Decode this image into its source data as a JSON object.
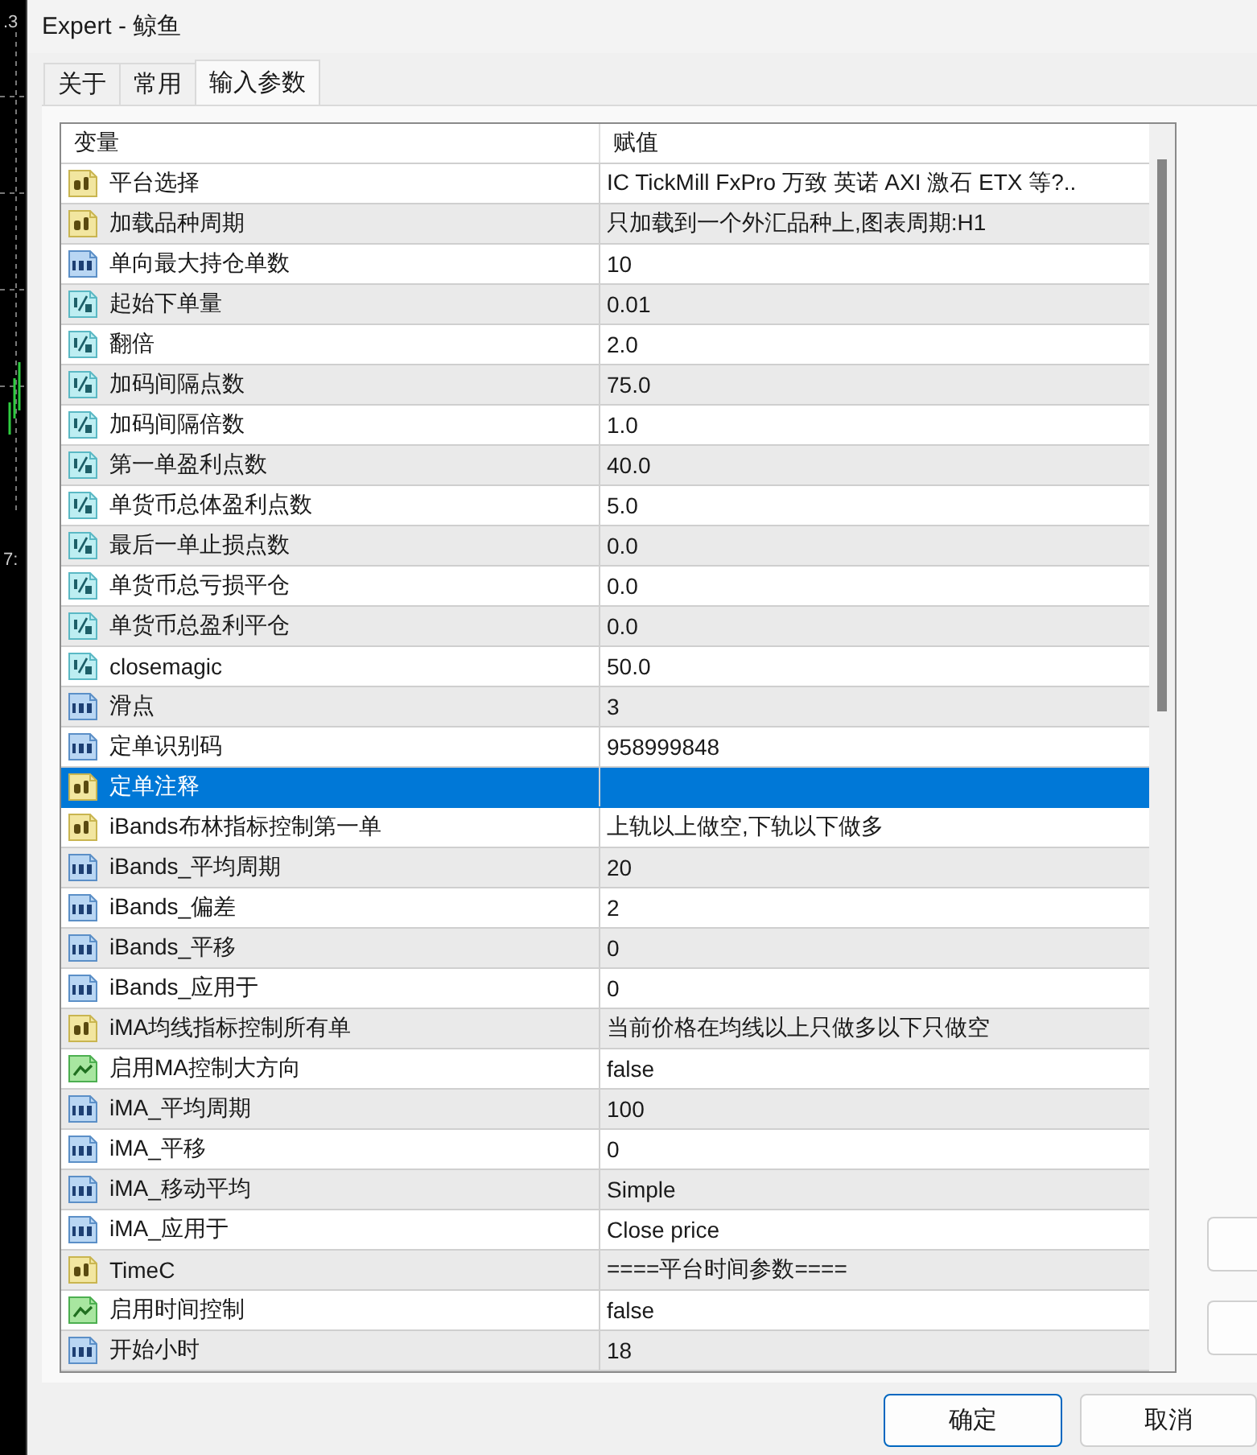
{
  "background_window": {
    "texts": [
      ".3",
      "7:"
    ]
  },
  "window": {
    "title": "Expert - 鲸鱼"
  },
  "tabs": [
    {
      "label": "关于",
      "selected": false
    },
    {
      "label": "常用",
      "selected": false
    },
    {
      "label": "输入参数",
      "selected": true
    }
  ],
  "table": {
    "columns": [
      "变量",
      "赋值"
    ],
    "rows": [
      {
        "kind": "string",
        "name": "平台选择",
        "value": "IC TickMill FxPro 万致 英诺 AXI 激石 ETX 等?..",
        "selected": false
      },
      {
        "kind": "string",
        "name": "加载品种周期",
        "value": "只加载到一个外汇品种上,图表周期:H1",
        "selected": false
      },
      {
        "kind": "int",
        "name": "单向最大持仓单数",
        "value": "10",
        "selected": false
      },
      {
        "kind": "double",
        "name": "起始下单量",
        "value": "0.01",
        "selected": false
      },
      {
        "kind": "double",
        "name": "翻倍",
        "value": "2.0",
        "selected": false
      },
      {
        "kind": "double",
        "name": "加码间隔点数",
        "value": "75.0",
        "selected": false
      },
      {
        "kind": "double",
        "name": "加码间隔倍数",
        "value": "1.0",
        "selected": false
      },
      {
        "kind": "double",
        "name": "第一单盈利点数",
        "value": "40.0",
        "selected": false
      },
      {
        "kind": "double",
        "name": "单货币总体盈利点数",
        "value": "5.0",
        "selected": false
      },
      {
        "kind": "double",
        "name": "最后一单止损点数",
        "value": "0.0",
        "selected": false
      },
      {
        "kind": "double",
        "name": "单货币总亏损平仓",
        "value": "0.0",
        "selected": false
      },
      {
        "kind": "double",
        "name": "单货币总盈利平仓",
        "value": "0.0",
        "selected": false
      },
      {
        "kind": "double",
        "name": "closemagic",
        "value": "50.0",
        "selected": false
      },
      {
        "kind": "int",
        "name": "滑点",
        "value": "3",
        "selected": false
      },
      {
        "kind": "int",
        "name": "定单识别码",
        "value": "958999848",
        "selected": false
      },
      {
        "kind": "string",
        "name": "定单注释",
        "selected": true
      },
      {
        "kind": "string",
        "name": "iBands布林指标控制第一单",
        "value": "上轨以上做空,下轨以下做多",
        "selected": false
      },
      {
        "kind": "int",
        "name": "iBands_平均周期",
        "value": "20",
        "selected": false
      },
      {
        "kind": "int",
        "name": "iBands_偏差",
        "value": "2",
        "selected": false
      },
      {
        "kind": "int",
        "name": "iBands_平移",
        "value": "0",
        "selected": false
      },
      {
        "kind": "int",
        "name": "iBands_应用于",
        "value": "0",
        "selected": false
      },
      {
        "kind": "string",
        "name": "iMA均线指标控制所有单",
        "value": "当前价格在均线以上只做多以下只做空",
        "selected": false
      },
      {
        "kind": "bool",
        "name": "启用MA控制大方向",
        "value": "false",
        "selected": false
      },
      {
        "kind": "int",
        "name": "iMA_平均周期",
        "value": "100",
        "selected": false
      },
      {
        "kind": "int",
        "name": "iMA_平移",
        "value": "0",
        "selected": false
      },
      {
        "kind": "int",
        "name": "iMA_移动平均",
        "value": "Simple",
        "selected": false
      },
      {
        "kind": "int",
        "name": "iMA_应用于",
        "value": "Close price",
        "selected": false
      },
      {
        "kind": "string",
        "name": "TimeC",
        "value": "====平台时间参数====",
        "selected": false
      },
      {
        "kind": "bool",
        "name": "启用时间控制",
        "value": "false",
        "selected": false
      },
      {
        "kind": "int",
        "name": "开始小时",
        "value": "18",
        "selected": false
      }
    ]
  },
  "buttons": [
    {
      "label": "确定",
      "default": true
    },
    {
      "label": "取消",
      "default": false
    }
  ]
}
